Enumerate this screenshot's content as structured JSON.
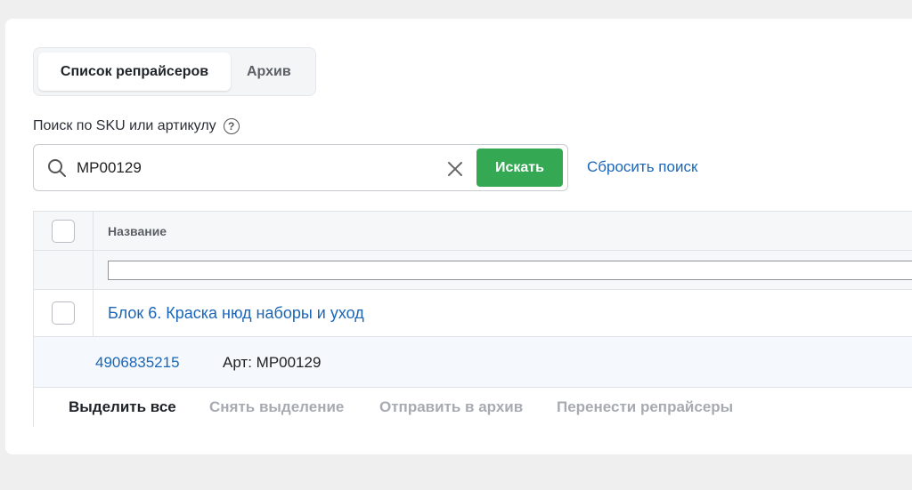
{
  "tabs": [
    {
      "label": "Список репрайсеров",
      "active": true
    },
    {
      "label": "Архив",
      "active": false
    }
  ],
  "search": {
    "label": "Поиск по SKU или артикулу",
    "value": "MP00129",
    "button_label": "Искать",
    "reset_label": "Сбросить поиск"
  },
  "table": {
    "columns": [
      "Название"
    ],
    "filter_value": "",
    "rows": [
      {
        "title": "Блок 6. Краска нюд наборы и уход",
        "sku": "4906835215",
        "article": "Арт: MP00129"
      }
    ]
  },
  "actions": [
    {
      "label": "Выделить все",
      "enabled": true
    },
    {
      "label": "Снять выделение",
      "enabled": false
    },
    {
      "label": "Отправить в архив",
      "enabled": false
    },
    {
      "label": "Перенести репрайсеры",
      "enabled": false
    }
  ],
  "colors": {
    "accent_green": "#34a853",
    "link_blue": "#1a66b8",
    "background": "#efefef"
  },
  "icons": [
    "search-icon",
    "clear-icon",
    "help-icon"
  ]
}
